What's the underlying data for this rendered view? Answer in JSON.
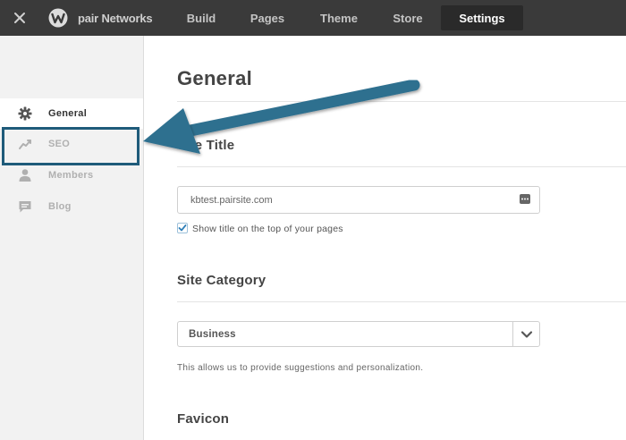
{
  "topbar": {
    "brand": "pair Networks",
    "nav": [
      {
        "label": "Build"
      },
      {
        "label": "Pages"
      },
      {
        "label": "Theme"
      },
      {
        "label": "Store"
      },
      {
        "label": "Settings"
      }
    ],
    "active_nav": "Settings"
  },
  "sidebar": {
    "items": [
      {
        "label": "General",
        "icon": "gear-icon"
      },
      {
        "label": "SEO",
        "icon": "trend-icon"
      },
      {
        "label": "Members",
        "icon": "person-icon"
      },
      {
        "label": "Blog",
        "icon": "comment-icon"
      }
    ],
    "active_item": "General"
  },
  "main": {
    "heading": "General",
    "site_title": {
      "heading": "Site Title",
      "value": "kbtest.pairsite.com",
      "show_title_checked": true,
      "show_title_label": "Show title on the top of your pages"
    },
    "site_category": {
      "heading": "Site Category",
      "selected": "Business",
      "hint": "This allows us to provide suggestions and personalization."
    },
    "favicon": {
      "heading": "Favicon"
    }
  },
  "colors": {
    "topbar_bg": "#3a3a3a",
    "sidebar_bg": "#f2f2f2",
    "annotation": "#2f6f8f"
  }
}
